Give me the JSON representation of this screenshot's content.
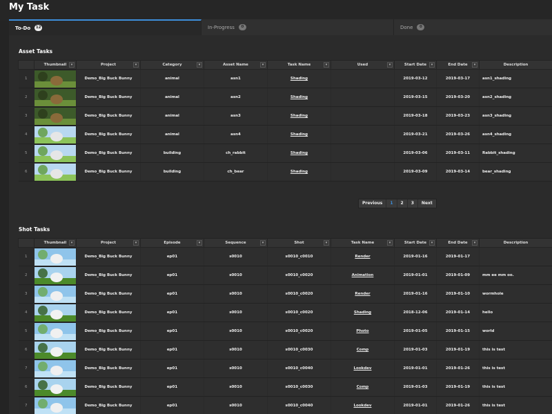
{
  "page": {
    "title": "My Task"
  },
  "tabs": [
    {
      "label": "To-Do",
      "count": "12"
    },
    {
      "label": "In-Progress",
      "count": "0"
    },
    {
      "label": "Done",
      "count": "0"
    }
  ],
  "asset_tasks": {
    "title": "Asset Tasks",
    "columns": [
      "Thumbnail",
      "Project",
      "Category",
      "Asset Name",
      "Task Name",
      "Used",
      "Start Date",
      "End Date",
      "Description"
    ],
    "rows": [
      {
        "n": "1",
        "project": "Demo_Big Buck Bunny",
        "category": "animal",
        "asset": "asn1",
        "task": "Shading",
        "used": "",
        "start": "2019-03-12",
        "end": "2019-03-17",
        "desc": "asn1_shading",
        "thumb": "forest"
      },
      {
        "n": "2",
        "project": "Demo_Big Buck Bunny",
        "category": "animal",
        "asset": "asn2",
        "task": "Shading",
        "used": "",
        "start": "2019-03-15",
        "end": "2019-03-20",
        "desc": "asn2_shading",
        "thumb": "forest"
      },
      {
        "n": "3",
        "project": "Demo_Big Buck Bunny",
        "category": "animal",
        "asset": "asn3",
        "task": "Shading",
        "used": "",
        "start": "2019-03-18",
        "end": "2019-03-23",
        "desc": "asn3_shading",
        "thumb": "forest"
      },
      {
        "n": "4",
        "project": "Demo_Big Buck Bunny",
        "category": "animal",
        "asset": "asn4",
        "task": "Shading",
        "used": "",
        "start": "2019-03-21",
        "end": "2019-03-26",
        "desc": "asn4_shading",
        "thumb": "meadow"
      },
      {
        "n": "5",
        "project": "Demo_Big Buck Bunny",
        "category": "building",
        "asset": "ch_rabbit",
        "task": "Shading",
        "used": "",
        "start": "2019-03-06",
        "end": "2019-03-11",
        "desc": "Rabbit_shading",
        "thumb": "meadow"
      },
      {
        "n": "6",
        "project": "Demo_Big Buck Bunny",
        "category": "building",
        "asset": "ch_bear",
        "task": "Shading",
        "used": "",
        "start": "2019-03-09",
        "end": "2019-03-14",
        "desc": "bear_shading",
        "thumb": "meadow"
      }
    ]
  },
  "pagination": {
    "prev": "Previous",
    "pages": [
      "1",
      "2",
      "3"
    ],
    "current": "1",
    "next": "Next"
  },
  "shot_tasks": {
    "title": "Shot Tasks",
    "columns": [
      "Thumbnail",
      "Project",
      "Episode",
      "Sequence",
      "Shot",
      "Task Name",
      "Start Date",
      "End Date",
      "Description"
    ],
    "rows": [
      {
        "n": "1",
        "project": "Demo_Big Buck Bunny",
        "episode": "ep01",
        "sequence": "s0010",
        "shot": "s0010_c0010",
        "task": "Render",
        "start": "2019-01-16",
        "end": "2019-01-17",
        "desc": "",
        "thumb": "sky"
      },
      {
        "n": "2",
        "project": "Demo_Big Buck Bunny",
        "episode": "ep01",
        "sequence": "s0010",
        "shot": "s0010_c0020",
        "task": "Animation",
        "start": "2019-01-01",
        "end": "2019-01-09",
        "desc": "mm ee mm oo.",
        "thumb": "tree"
      },
      {
        "n": "3",
        "project": "Demo_Big Buck Bunny",
        "episode": "ep01",
        "sequence": "s0010",
        "shot": "s0010_c0020",
        "task": "Render",
        "start": "2019-01-16",
        "end": "2019-01-10",
        "desc": "wormhole",
        "thumb": "sky"
      },
      {
        "n": "4",
        "project": "Demo_Big Buck Bunny",
        "episode": "ep01",
        "sequence": "s0010",
        "shot": "s0010_c0020",
        "task": "Shading",
        "start": "2018-12-06",
        "end": "2019-01-14",
        "desc": "hello",
        "thumb": "tree"
      },
      {
        "n": "5",
        "project": "Demo_Big Buck Bunny",
        "episode": "ep01",
        "sequence": "s0010",
        "shot": "s0010_c0020",
        "task": "Photo",
        "start": "2019-01-05",
        "end": "2019-01-15",
        "desc": "world",
        "thumb": "sky"
      },
      {
        "n": "6",
        "project": "Demo_Big Buck Bunny",
        "episode": "ep01",
        "sequence": "s0010",
        "shot": "s0010_c0030",
        "task": "Comp",
        "start": "2019-01-03",
        "end": "2019-01-19",
        "desc": "this is test",
        "thumb": "tree"
      },
      {
        "n": "7",
        "project": "Demo_Big Buck Bunny",
        "episode": "ep01",
        "sequence": "s0010",
        "shot": "s0010_c0040",
        "task": "Lookdev",
        "start": "2019-01-01",
        "end": "2019-01-26",
        "desc": "this is test",
        "thumb": "sky"
      },
      {
        "n": "6",
        "project": "Demo_Big Buck Bunny",
        "episode": "ep01",
        "sequence": "s0010",
        "shot": "s0010_c0030",
        "task": "Comp",
        "start": "2019-01-03",
        "end": "2019-01-19",
        "desc": "this is test",
        "thumb": "tree"
      },
      {
        "n": "7",
        "project": "Demo_Big Buck Bunny",
        "episode": "ep01",
        "sequence": "s0010",
        "shot": "s0010_c0040",
        "task": "Lookdev",
        "start": "2019-01-01",
        "end": "2019-01-26",
        "desc": "this is test",
        "thumb": "sky"
      }
    ]
  },
  "colors": {
    "accent": "#3d8fdc",
    "background": "#2b2b2b",
    "header": "#333333"
  }
}
